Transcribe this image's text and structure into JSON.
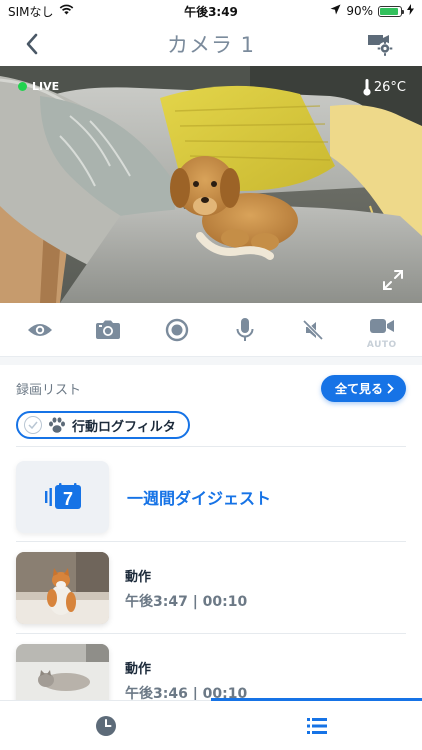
{
  "status_bar": {
    "carrier": "SIMなし",
    "time": "午後3:49",
    "battery": "90%",
    "battery_level": 0.9
  },
  "nav": {
    "title": "カメラ 1"
  },
  "camera": {
    "live_label": "LIVE",
    "temperature": "26°C"
  },
  "controls": {
    "auto_label": "AUTO"
  },
  "recording": {
    "title": "録画リスト",
    "see_all_label": "全て見る",
    "filter_label": "行動ログフィルタ",
    "digest": {
      "label": "一週間ダイジェスト",
      "icon_number": "7"
    },
    "items": [
      {
        "type": "動作",
        "time": "午後3:47 | 00:10"
      },
      {
        "type": "動作",
        "time": "午後3:46 | 00:10"
      }
    ]
  },
  "colors": {
    "accent": "#1673e6",
    "live": "#22d34f",
    "icon": "#7b8b9c"
  }
}
